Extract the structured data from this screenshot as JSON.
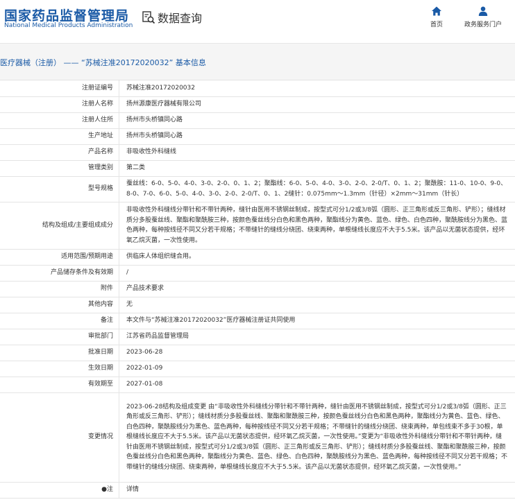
{
  "header": {
    "logo_cn": "国家药品监督管理局",
    "logo_en": "National Medical Products Administration",
    "query_label": "数据查询",
    "home_label": "首页",
    "service_label": "政务服务门户"
  },
  "section_title": "医疗器械（注册） —— “苏械注准20172020032” 基本信息",
  "rows": [
    {
      "key": "注册证编号",
      "value": "苏械注准20172020032"
    },
    {
      "key": "注册人名称",
      "value": "扬州源康医疗器械有限公司"
    },
    {
      "key": "注册人住所",
      "value": "扬州市头桥镇同心路"
    },
    {
      "key": "生产地址",
      "value": "扬州市头桥镇同心路"
    },
    {
      "key": "产品名称",
      "value": "非吸收性外科缝线"
    },
    {
      "key": "管理类别",
      "value": "第二类"
    },
    {
      "key": "型号规格",
      "value": "蚕丝线：6-0、5-0、4-0、3-0、2-0、0、1、2；聚酯线：6-0、5-0、4-0、3-0、2-0、2-0/T、0、1、2；聚酰胺：11-0、10-0、9-0、8-0、7-0、6-0、5-0、4-0、3-0、2-0、2-0/T、0、1、2缝针：0.075mm～1.3mm（针径）×2mm～31mm（针长）"
    },
    {
      "key": "结构及组成/主要组成成分",
      "value": "非吸收性外科缝线分带针和不带针两种，缝针由医用不锈钢丝制成，按型式可分1/2或3/8弧（圆形、正三角形或反三角形、铲形）；缝线材质分多股蚕丝线、聚酯和聚酰胺三种，按颜色蚕丝线分白色和黑色两种，聚酯线分为黄色、蓝色、绿色、白色四种，聚酰胺线分为黑色、蓝色两种，每种按线径不同又分若干规格；不带缝针的缝线分绕团、绕束两种，单根缝线长度应不大于5.5米。该产品以无菌状态提供，经环氧乙烷灭菌，一次性使用。"
    },
    {
      "key": "适用范围/预期用途",
      "value": "供临床人体组织缝合用。"
    },
    {
      "key": "产品储存条件及有效期",
      "value": "/"
    },
    {
      "key": "附件",
      "value": "产品技术要求"
    },
    {
      "key": "其他内容",
      "value": "无"
    },
    {
      "key": "备注",
      "value": "本文件与“苏械注准20172020032”医疗器械注册证共同使用"
    },
    {
      "key": "审批部门",
      "value": "江苏省药品监督管理局"
    },
    {
      "key": "批准日期",
      "value": "2023-06-28"
    },
    {
      "key": "生效日期",
      "value": "2022-01-09"
    },
    {
      "key": "有效期至",
      "value": "2027-01-08"
    },
    {
      "key": "变更情况",
      "value": "2023-06-28结构及组成变更 由“非吸收性外科缝线分带针和不带针两种，缝针由医用不锈钢丝制成，按型式可分1/2或3/8弧（圆形、正三角形或反三角形、铲形）；缝线材质分多股蚕丝线、聚酯和聚酰胺三种，按颜色蚕丝线分白色和黑色两种，聚酯线分为黄色、蓝色、绿色、白色四种，聚酰胺线分为黑色、蓝色两种，每种按线径不同又分若干规格；不带缝针的缝线分绕团、绕束两种，单包线束不多于30根，单根缝线长度应不大于5.5米。该产品以无菌状态提供，经环氧乙烷灭菌，一次性使用。”变更为“非吸收性外科缝线分带针和不带针两种，缝针由医用不锈钢丝制成，按型式可分1/2或3/8弧（圆形、正三角形或反三角形、铲形）；缝线材质分多股蚕丝线、聚酯和聚酰胺三种，按颜色蚕丝线分白色和黑色两种，聚酯线分为黄色、蓝色、绿色、白色四种，聚酰胺线分为黑色、蓝色两种，每种按线径不同又分若干规格；不带缝针的缝线分绕团、绕束两种，单根缝线长度应不大于5.5米。该产品以无菌状态提供，经环氧乙烷灭菌，一次性使用。”"
    },
    {
      "key": "●注",
      "value": "详情"
    }
  ]
}
